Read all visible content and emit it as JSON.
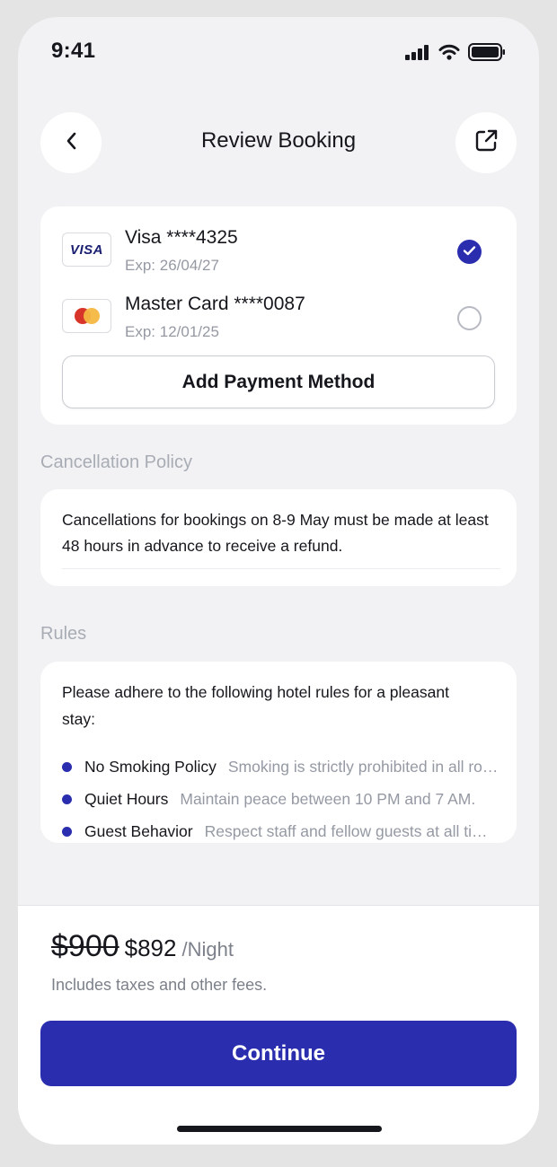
{
  "status_bar": {
    "time": "9:41"
  },
  "header": {
    "title": "Review Booking"
  },
  "payment": {
    "cards": [
      {
        "brand": "VISA",
        "name": "Visa ****4325",
        "exp": "Exp: 26/04/27",
        "selected": true
      },
      {
        "brand": "Mastercard",
        "name": "Master Card ****0087",
        "exp": "Exp: 12/01/25",
        "selected": false
      }
    ],
    "add_button_label": "Add Payment Method"
  },
  "cancellation": {
    "label": "Cancellation Policy",
    "text": "Cancellations for bookings on 8-9 May must be made at least 48 hours in advance to receive a refund."
  },
  "rules": {
    "label": "Rules",
    "intro": "Please adhere to the following hotel rules for a pleasant stay:",
    "items": [
      {
        "title": "No Smoking Policy",
        "desc": "Smoking is strictly prohibited in all rooms and indoor areas."
      },
      {
        "title": "Quiet Hours",
        "desc": "Maintain peace between 10 PM and 7 AM."
      },
      {
        "title": "Guest Behavior",
        "desc": "Respect staff and fellow guests at all times."
      }
    ]
  },
  "footer": {
    "old_price": "$900",
    "new_price": "$892",
    "per_night": "/Night",
    "tax_note": "Includes taxes and other fees.",
    "continue_label": "Continue"
  },
  "colors": {
    "accent": "#2A2EAE",
    "background": "#F2F2F4",
    "muted_text": "#9599A3"
  },
  "icons": [
    "signal-icon",
    "wifi-icon",
    "battery-icon",
    "back-arrow-icon",
    "share-icon",
    "checkmark-icon",
    "mastercard-logo-icon",
    "visa-logo-icon"
  ]
}
